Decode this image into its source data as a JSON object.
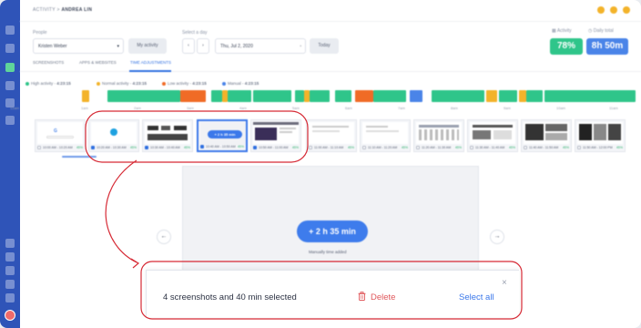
{
  "breadcrumb": {
    "section": "ACTIVITY",
    "separator": ">",
    "user": "ANDREA LIN"
  },
  "filters": {
    "people_label": "People",
    "people_value": "Kristen Weber",
    "my_activity_button": "My activity",
    "day_label": "Select a day",
    "date_value": "Thu, Jul 2, 2020",
    "today_button": "Today"
  },
  "stats": {
    "activity_label": "Activity",
    "activity_value": "78%",
    "daily_total_label": "Daily total",
    "daily_total_value": "8h 50m",
    "activity_color": "#2fc58a",
    "daily_total_color": "#4a84e8"
  },
  "tabs": [
    {
      "label": "SCREENSHOTS"
    },
    {
      "label": "APPS & WEBSITES"
    },
    {
      "label": "TIME ADJUSTMENTS"
    }
  ],
  "legend": [
    {
      "label": "High activity -",
      "value": "4:23:15",
      "color": "#2fc58a"
    },
    {
      "label": "Normal activity -",
      "value": "4:23:15",
      "color": "#f3b32a"
    },
    {
      "label": "Low activity -",
      "value": "4:23:15",
      "color": "#f06b26"
    },
    {
      "label": "Manual -",
      "value": "4:23:15",
      "color": "#4a84e8"
    }
  ],
  "timeline_ticks": [
    "12am",
    "1am",
    "2am",
    "3am",
    "4am",
    "5am",
    "6am",
    "7am",
    "8am",
    "9am",
    "10am",
    "11am"
  ],
  "screenshots": [
    {
      "caption": "10:00 AM - 10:20 AM",
      "pct": "45%",
      "selected": false,
      "app": "google"
    },
    {
      "caption": "10:20 AM - 10:30 AM",
      "pct": "45%",
      "selected": true,
      "app": "skype"
    },
    {
      "caption": "10:30 AM - 10:40 AM",
      "pct": "45%",
      "selected": true,
      "app": "slides"
    },
    {
      "caption": "10:40 AM - 10:50 AM",
      "pct": "45%",
      "selected": true,
      "app": "manual"
    },
    {
      "caption": "10:50 AM - 11:00 AM",
      "pct": "45%",
      "selected": true,
      "app": "editor"
    },
    {
      "caption": "11:00 AM - 11:10 AM",
      "pct": "45%",
      "selected": false,
      "app": "doc"
    },
    {
      "caption": "11:10 AM - 11:20 AM",
      "pct": "45%",
      "selected": false,
      "app": "doc"
    },
    {
      "caption": "11:20 AM - 11:30 AM",
      "pct": "45%",
      "selected": false,
      "app": "grid"
    },
    {
      "caption": "11:30 AM - 11:40 AM",
      "pct": "45%",
      "selected": false,
      "app": "doc"
    },
    {
      "caption": "11:40 AM - 11:50 AM",
      "pct": "45%",
      "selected": false,
      "app": "web"
    },
    {
      "caption": "11:50 AM - 12:00 PM",
      "pct": "45%",
      "selected": false,
      "app": "photos"
    }
  ],
  "manual_pill_small": "+ 2 h 35 min",
  "preview": {
    "pill": "+ 2 h 35 min",
    "sub_label": "Manually time added",
    "prev_arrow": "←",
    "next_arrow": "→"
  },
  "selection_bar": {
    "summary": "4 screenshots and 40 min selected",
    "delete_label": "Delete",
    "select_all_label": "Select all",
    "close_glyph": "×",
    "delete_color": "#e0585c",
    "select_all_color": "#3b78ea"
  },
  "annotation_color": "#d62a35"
}
